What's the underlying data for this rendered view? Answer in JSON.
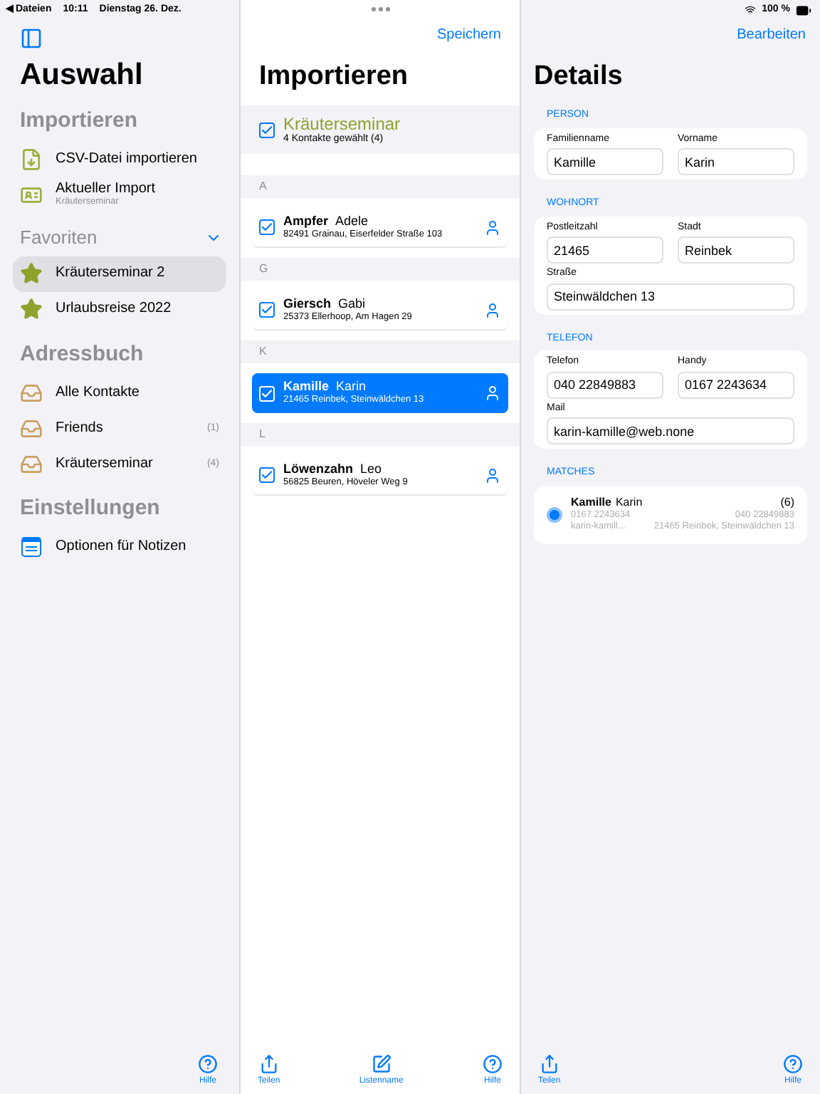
{
  "status_bar": {
    "back": "◀ Dateien",
    "time": "10:11",
    "date": "Dienstag 26. Dez.",
    "battery": "100 %"
  },
  "sidebar": {
    "title": "Auswahl",
    "sections": [
      {
        "title": "Importieren",
        "collapsible": false,
        "items": [
          {
            "kind": "import",
            "label": "CSV-Datei importieren",
            "selected": false
          },
          {
            "kind": "card",
            "label": "Aktueller Import",
            "subtitle": "Kräuterseminar",
            "selected": false
          }
        ]
      },
      {
        "title": "Favoriten",
        "collapsible": true,
        "items": [
          {
            "kind": "star",
            "label": "Kräuterseminar 2",
            "selected": true
          },
          {
            "kind": "star",
            "label": "Urlaubsreise 2022",
            "selected": false
          }
        ]
      },
      {
        "title": "Adressbuch",
        "collapsible": false,
        "items": [
          {
            "kind": "tray",
            "label": "Alle Kontakte",
            "selected": false
          },
          {
            "kind": "tray",
            "label": "Friends",
            "count": "(1)",
            "selected": false
          },
          {
            "kind": "tray",
            "label": "Kräuterseminar",
            "count": "(4)",
            "selected": false
          }
        ]
      },
      {
        "title": "Einstellungen",
        "collapsible": false,
        "items": [
          {
            "kind": "notes",
            "label": "Optionen für Notizen",
            "selected": false
          }
        ]
      }
    ],
    "toolbar": [
      {
        "kind": "help",
        "label": "Hilfe"
      }
    ]
  },
  "import": {
    "action": "Speichern",
    "title": "Importieren",
    "group": {
      "title": "Kräuterseminar",
      "subtitle": "4 Kontakte gewählt (4)",
      "checked": true
    },
    "sections": [
      {
        "letter": "A",
        "contacts": [
          {
            "last": "Ampfer",
            "first": "Adele",
            "address": "82491 Grainau, Eiserfelder Straße 103",
            "checked": true,
            "selected": false
          }
        ]
      },
      {
        "letter": "G",
        "contacts": [
          {
            "last": "Giersch",
            "first": "Gabi",
            "address": "25373 Ellerhoop, Am Hagen 29",
            "checked": true,
            "selected": false
          }
        ]
      },
      {
        "letter": "K",
        "contacts": [
          {
            "last": "Kamille",
            "first": "Karin",
            "address": "21465 Reinbek, Steinwäldchen 13",
            "checked": true,
            "selected": true
          }
        ]
      },
      {
        "letter": "L",
        "contacts": [
          {
            "last": "Löwenzahn",
            "first": "Leo",
            "address": "56825 Beuren, Höveler Weg 9",
            "checked": true,
            "selected": false
          }
        ]
      }
    ],
    "toolbar": [
      {
        "kind": "share",
        "label": "Teilen"
      },
      {
        "kind": "edit",
        "label": "Listenname"
      },
      {
        "kind": "help",
        "label": "Hilfe"
      }
    ]
  },
  "details": {
    "action": "Bearbeiten",
    "title": "Details",
    "sections": [
      {
        "title": "PERSON",
        "rows": [
          [
            {
              "label": "Familienname",
              "value": "Kamille"
            },
            {
              "label": "Vorname",
              "value": "Karin"
            }
          ]
        ]
      },
      {
        "title": "WOHNORT",
        "rows": [
          [
            {
              "label": "Postleitzahl",
              "value": "21465"
            },
            {
              "label": "Stadt",
              "value": "Reinbek"
            }
          ],
          [
            {
              "label": "Straße",
              "value": "Steinwäldchen 13"
            }
          ]
        ]
      },
      {
        "title": "TELEFON",
        "rows": [
          [
            {
              "label": "Telefon",
              "value": "040 22849883"
            },
            {
              "label": "Handy",
              "value": "0167 2243634"
            }
          ],
          [
            {
              "label": "Mail",
              "value": "karin-kamille@web.none"
            }
          ]
        ]
      }
    ],
    "matches_title": "MATCHES",
    "matches": [
      {
        "last": "Kamille",
        "first": "Karin",
        "count": "(6)",
        "phone_left": "0167 2243634",
        "phone_right": "040 22849883",
        "mail": "karin-kamill...",
        "address": "21465 Reinbek, Steinwäldchen 13",
        "selected": true
      }
    ],
    "toolbar": [
      {
        "kind": "share",
        "label": "Teilen"
      },
      {
        "kind": "help",
        "label": "Hilfe"
      }
    ]
  }
}
